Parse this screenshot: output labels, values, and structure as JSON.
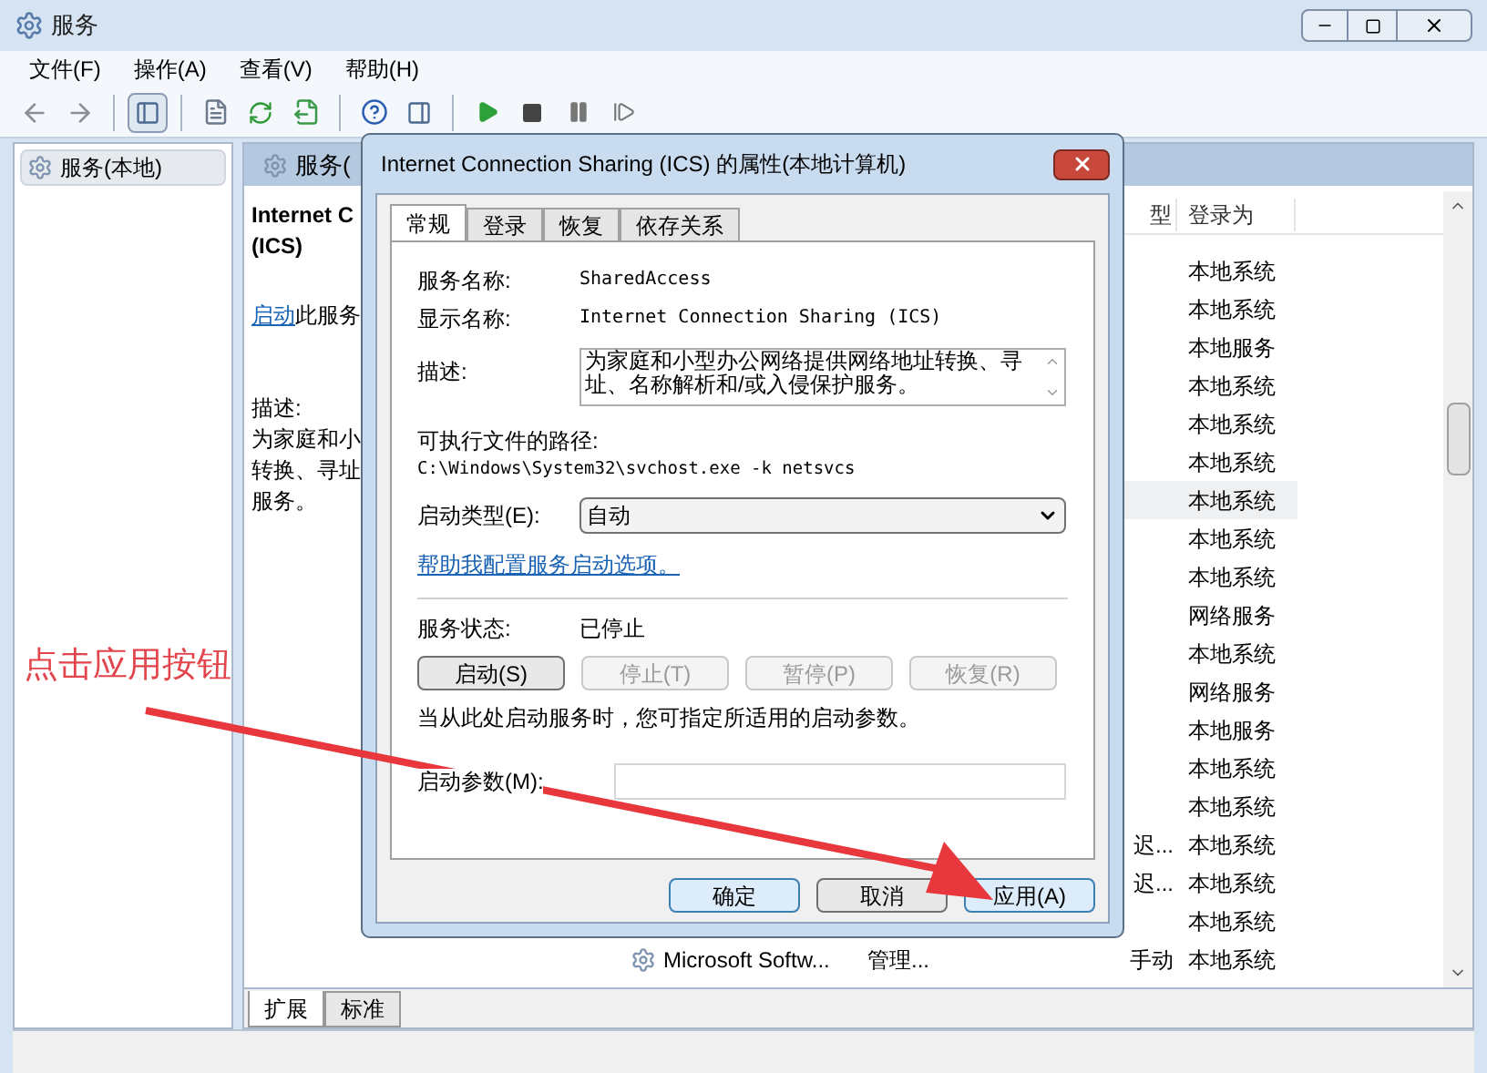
{
  "window": {
    "title": "服务"
  },
  "menu": [
    {
      "label": "文件(F)"
    },
    {
      "label": "操作(A)"
    },
    {
      "label": "查看(V)"
    },
    {
      "label": "帮助(H)"
    }
  ],
  "tree": [
    {
      "label": "服务(本地)",
      "selected": true
    }
  ],
  "panel": {
    "title": "服务(",
    "service_name": [
      "Internet C",
      "(ICS)"
    ],
    "action_link": "启动",
    "action_text": "此服务",
    "description_label": "描述:",
    "description_lines": [
      "为家庭和小",
      "转换、寻址",
      "服务。"
    ]
  },
  "list": {
    "columns": [
      {
        "label": "型"
      },
      {
        "label": "登录为"
      }
    ],
    "rows": [
      {
        "logon": "本地系统",
        "selected": false
      },
      {
        "logon": "本地系统",
        "selected": false
      },
      {
        "logon": "本地服务",
        "selected": false
      },
      {
        "logon": "本地系统",
        "selected": false
      },
      {
        "logon": "本地系统",
        "selected": false
      },
      {
        "logon": "本地系统",
        "selected": false
      },
      {
        "logon": "本地系统",
        "selected": true
      },
      {
        "logon": "本地系统",
        "selected": false
      },
      {
        "logon": "本地系统",
        "selected": false
      },
      {
        "logon": "网络服务",
        "selected": false
      },
      {
        "logon": "本地系统",
        "selected": false
      },
      {
        "logon": "网络服务",
        "selected": false
      },
      {
        "logon": "本地服务",
        "selected": false
      },
      {
        "logon": "本地系统",
        "selected": false
      },
      {
        "logon": "本地系统",
        "selected": false
      },
      {
        "startup": "迟...",
        "logon": "本地系统",
        "selected": false
      },
      {
        "startup": "迟...",
        "logon": "本地系统",
        "selected": false
      },
      {
        "logon": "本地系统",
        "selected": false
      },
      {
        "name": "Microsoft Softw...",
        "description": "管理...",
        "startup": "手动",
        "logon": "本地系统",
        "selected": false
      }
    ]
  },
  "bottom_tabs": [
    {
      "label": "扩展",
      "selected": true
    },
    {
      "label": "标准",
      "selected": false
    }
  ],
  "dialog": {
    "title": "Internet Connection Sharing (ICS) 的属性(本地计算机)",
    "tabs": [
      {
        "label": "常规",
        "selected": true
      },
      {
        "label": "登录",
        "selected": false
      },
      {
        "label": "恢复",
        "selected": false
      },
      {
        "label": "依存关系",
        "selected": false
      }
    ],
    "fields": [
      {
        "label": "服务名称:",
        "value": "SharedAccess"
      },
      {
        "label": "显示名称:",
        "value": "Internet Connection Sharing (ICS)"
      }
    ],
    "description": {
      "label": "描述:",
      "value": "为家庭和小型办公网络提供网络地址转换、寻址、名称解析和/或入侵保护服务。"
    },
    "path": {
      "label": "可执行文件的路径:",
      "value": "C:\\Windows\\System32\\svchost.exe -k netsvcs"
    },
    "startup_type": {
      "label": "启动类型(E):",
      "value": "自动"
    },
    "help_link": "帮助我配置服务启动选项。",
    "status": {
      "label": "服务状态:",
      "value": "已停止"
    },
    "service_buttons": [
      {
        "label": "启动(S)",
        "disabled": false
      },
      {
        "label": "停止(T)",
        "disabled": true
      },
      {
        "label": "暂停(P)",
        "disabled": true
      },
      {
        "label": "恢复(R)",
        "disabled": true
      }
    ],
    "hint": "当从此处启动服务时，您可指定所适用的启动参数。",
    "params": {
      "label": "启动参数(M):"
    },
    "buttons": [
      {
        "label": "确定",
        "highlighted": true
      },
      {
        "label": "取消",
        "highlighted": false
      },
      {
        "label": "应用(A)",
        "highlighted": true
      }
    ]
  },
  "annotation": {
    "text": "点击应用按钮"
  }
}
